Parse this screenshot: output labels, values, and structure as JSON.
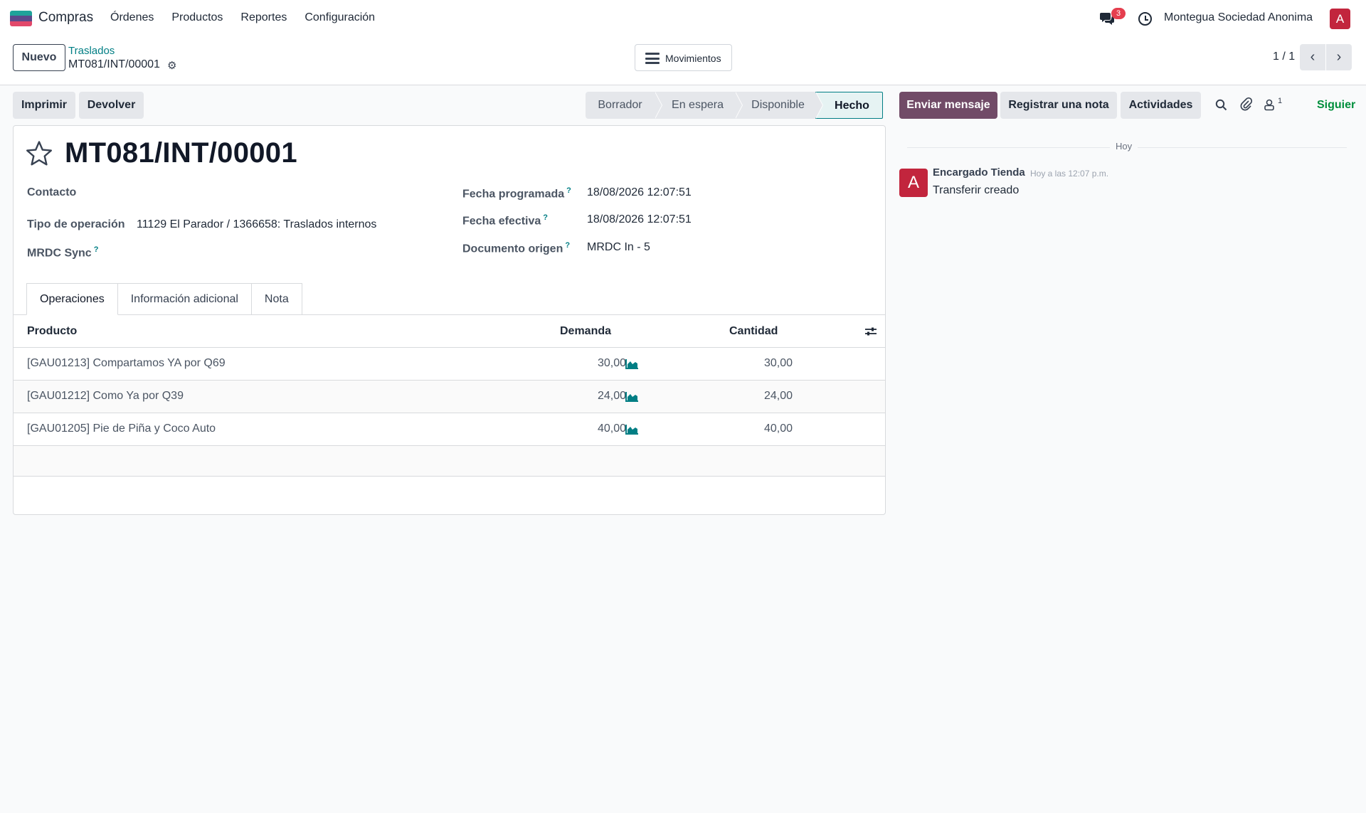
{
  "navbar": {
    "app_name": "Compras",
    "menu": [
      "Órdenes",
      "Productos",
      "Reportes",
      "Configuración"
    ],
    "chat_badge": "3",
    "company": "Montegua Sociedad Anonima",
    "avatar_letter": "A"
  },
  "control": {
    "new_label": "Nuevo",
    "breadcrumb_parent": "Traslados",
    "breadcrumb_current": "MT081/INT/00001",
    "moves_label": "Movimientos",
    "pager": "1 / 1"
  },
  "actions": {
    "print_label": "Imprimir",
    "return_label": "Devolver",
    "statuses": [
      "Borrador",
      "En espera",
      "Disponible",
      "Hecho"
    ],
    "active_status": "Hecho"
  },
  "chatter_actions": {
    "send_message": "Enviar mensaje",
    "log_note": "Registrar una nota",
    "activities": "Actividades",
    "follower_count": "1",
    "follow": "Siguier"
  },
  "form": {
    "title": "MT081/INT/00001",
    "contact_label": "Contacto",
    "operation_type_label": "Tipo de operación",
    "operation_type_value": "11129 El Parador / 1366658: Traslados internos",
    "mrdc_sync_label": "MRDC Sync",
    "scheduled_date_label": "Fecha programada",
    "scheduled_date_value": "18/08/2026 12:07:51",
    "effective_date_label": "Fecha efectiva",
    "effective_date_value": "18/08/2026 12:07:51",
    "source_doc_label": "Documento origen",
    "source_doc_value": "MRDC In - 5",
    "help_mark": "?"
  },
  "tabs": [
    "Operaciones",
    "Información adicional",
    "Nota"
  ],
  "table": {
    "headers": {
      "product": "Producto",
      "demand": "Demanda",
      "quantity": "Cantidad"
    },
    "rows": [
      {
        "product": "[GAU01213] Compartamos YA por Q69",
        "demand": "30,00",
        "quantity": "30,00"
      },
      {
        "product": "[GAU01212] Como Ya por Q39",
        "demand": "24,00",
        "quantity": "24,00"
      },
      {
        "product": "[GAU01205] Pie de Piña y Coco Auto",
        "demand": "40,00",
        "quantity": "40,00"
      }
    ]
  },
  "chatter": {
    "date": "Hoy",
    "message": {
      "avatar_letter": "A",
      "author": "Encargado Tienda",
      "time": "Hoy a las 12:07 p.m.",
      "body": "Transferir creado"
    }
  },
  "colors": {
    "brand": "#714b67",
    "link": "#017e84",
    "avatar": "#c2253d",
    "badge": "#e53e4e",
    "follow": "#008f3c"
  }
}
